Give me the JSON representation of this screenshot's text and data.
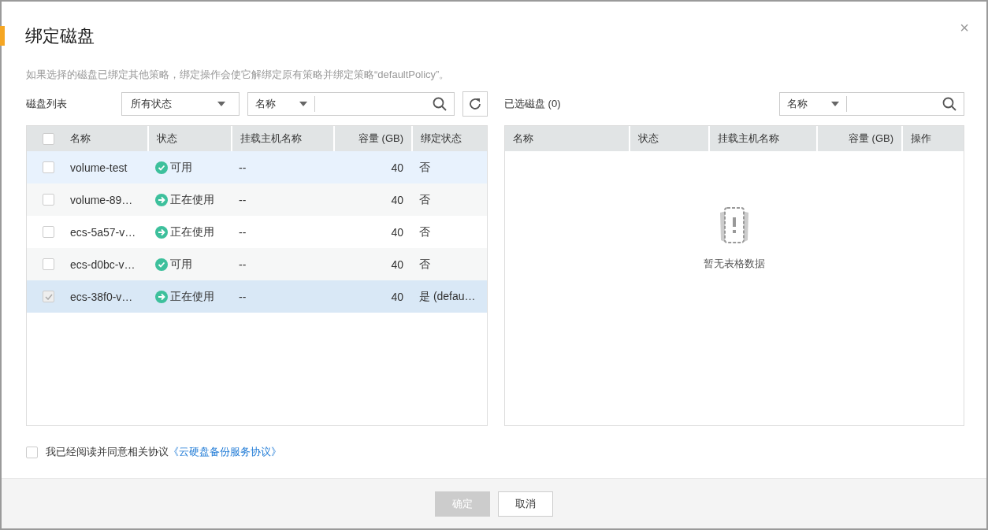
{
  "dialog": {
    "title": "绑定磁盘",
    "close": "×",
    "notice": "如果选择的磁盘已绑定其他策略，绑定操作会使它解绑定原有策略并绑定策略“defaultPolicy”。"
  },
  "left": {
    "label": "磁盘列表",
    "status_filter": "所有状态",
    "search_field": "名称",
    "columns": [
      "名称",
      "状态",
      "挂载主机名称",
      "容量 (GB)",
      "绑定状态"
    ],
    "all_checked": false,
    "rows": [
      {
        "name": "volume-test",
        "status": "可用",
        "kind": "available",
        "host": "--",
        "capacity": "40",
        "bound": "否",
        "checked": false,
        "disabled": false,
        "selected": false,
        "hovered": true
      },
      {
        "name": "volume-89…",
        "status": "正在使用",
        "kind": "in_use",
        "host": "--",
        "capacity": "40",
        "bound": "否",
        "checked": false,
        "disabled": false,
        "selected": false,
        "hovered": false
      },
      {
        "name": "ecs-5a57-v…",
        "status": "正在使用",
        "kind": "in_use",
        "host": "--",
        "capacity": "40",
        "bound": "否",
        "checked": false,
        "disabled": false,
        "selected": false,
        "hovered": false
      },
      {
        "name": "ecs-d0bc-v…",
        "status": "可用",
        "kind": "available",
        "host": "--",
        "capacity": "40",
        "bound": "否",
        "checked": false,
        "disabled": false,
        "selected": false,
        "hovered": false
      },
      {
        "name": "ecs-38f0-v…",
        "status": "正在使用",
        "kind": "in_use",
        "host": "--",
        "capacity": "40",
        "bound": "是 (defau…",
        "checked": true,
        "disabled": true,
        "selected": true,
        "hovered": false
      }
    ]
  },
  "right": {
    "label": "已选磁盘 (0)",
    "search_field": "名称",
    "columns": [
      "名称",
      "状态",
      "挂载主机名称",
      "容量 (GB)",
      "操作"
    ],
    "empty_text": "暂无表格数据"
  },
  "agreement": {
    "checked": false,
    "text": "我已经阅读并同意相关协议",
    "link": "《云硬盘备份服务协议》"
  },
  "buttons": [
    {
      "label": "确定",
      "kind": "primary",
      "disabled": true
    },
    {
      "label": "取消",
      "kind": "default",
      "disabled": false
    }
  ]
}
